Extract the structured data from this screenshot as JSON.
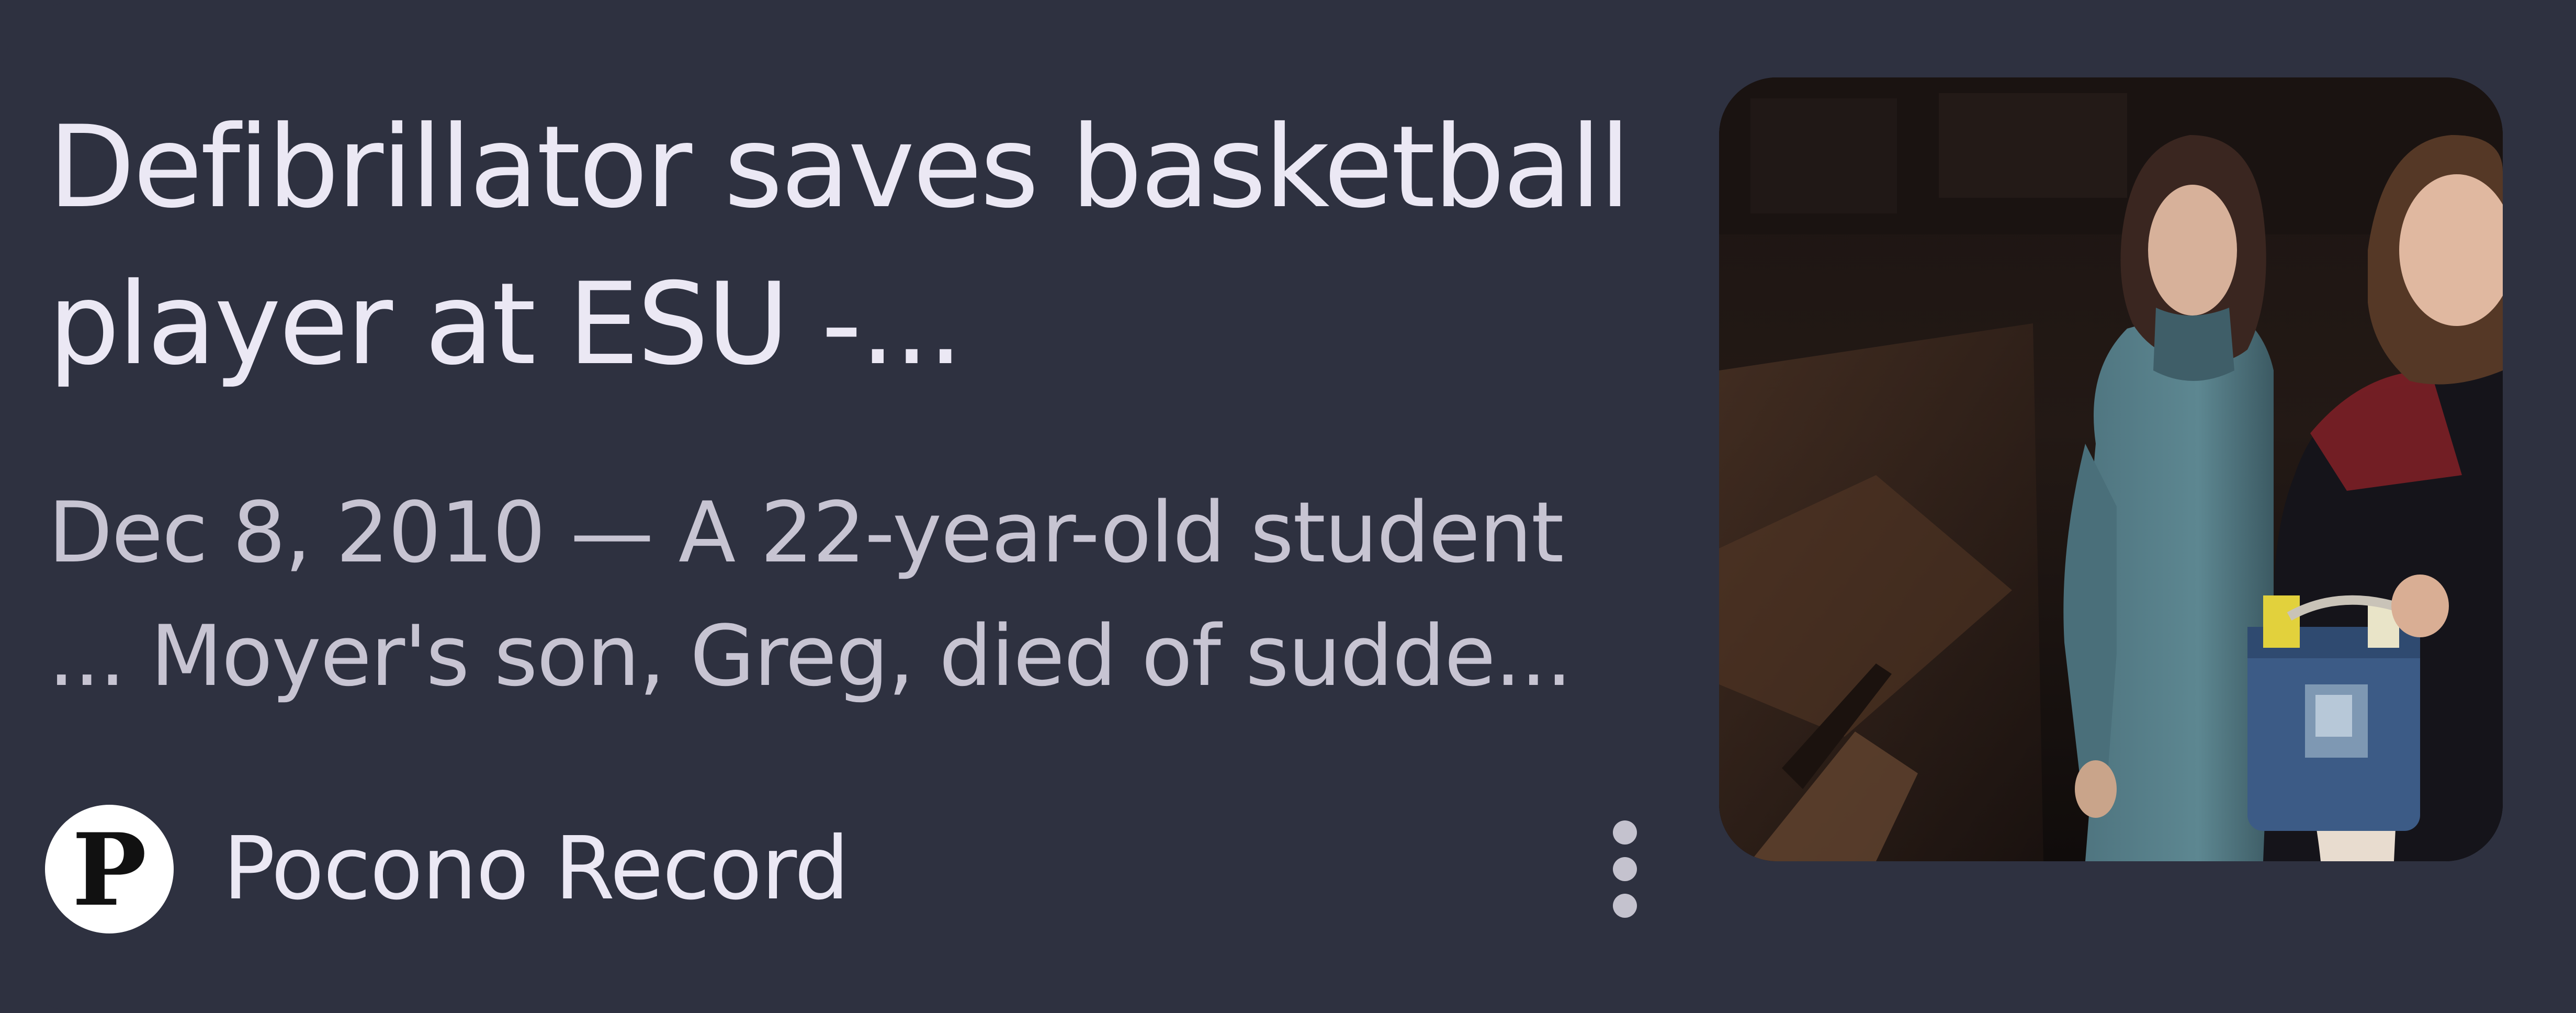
{
  "result": {
    "headline": "Defibrillator saves basketball player at ESU -...",
    "snippet": "Dec 8, 2010 — A 22-year-old student ... Moyer's son, Greg, died of sudde...",
    "source": {
      "name": "Pocono Record",
      "logo_letter": "P"
    },
    "more_options_icon": "more-vert-icon",
    "thumbnail": {
      "subject": "two women in a gymnasium holding a defibrillator case"
    }
  }
}
